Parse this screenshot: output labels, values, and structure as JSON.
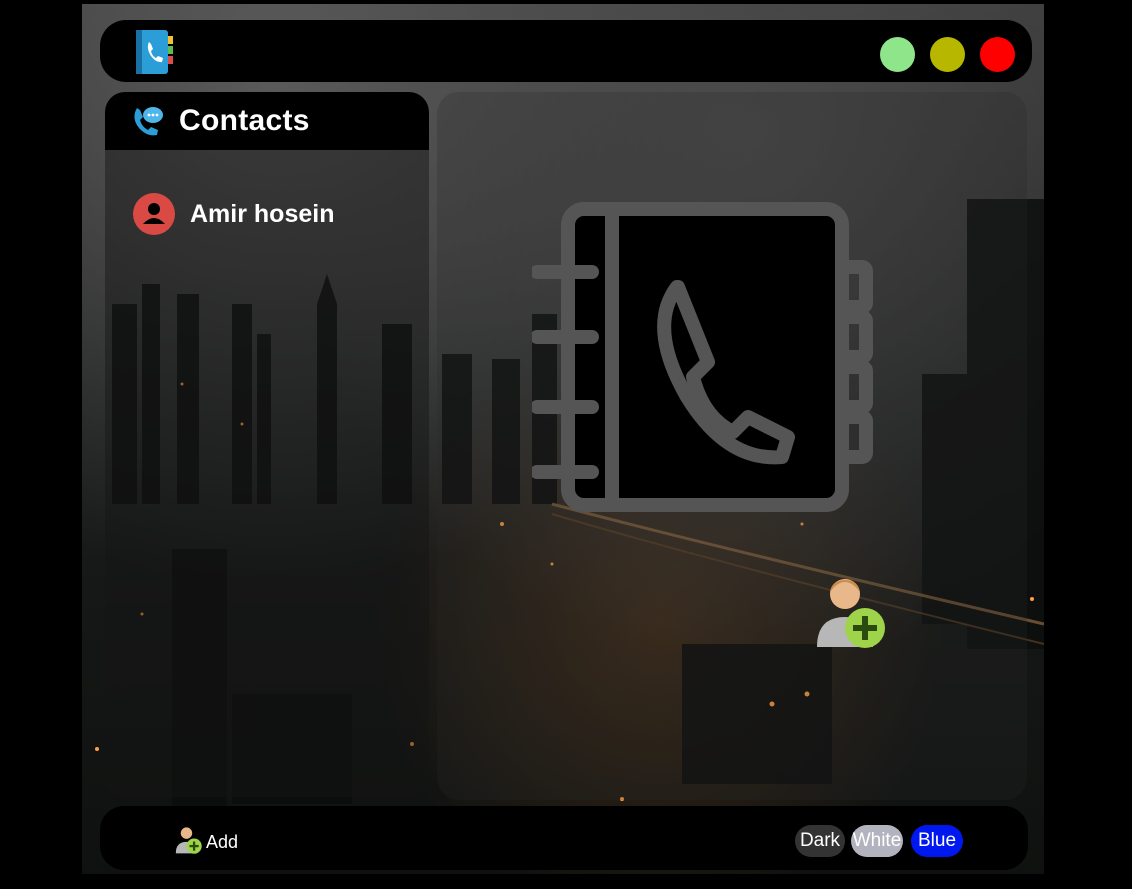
{
  "sidebar": {
    "title": "Contacts",
    "contacts": [
      {
        "name": "Amir hosein"
      }
    ]
  },
  "toolbar": {
    "add_label": "Add",
    "themes": [
      "Dark",
      "White",
      "Blue"
    ]
  },
  "icons": {
    "app": "contacts-book-icon",
    "header": "chat-phone-icon",
    "avatar": "user-avatar-icon",
    "main": "phonebook-icon",
    "add_contact": "add-user-icon"
  },
  "colors": {
    "minimize": "#8fe68a",
    "maximize": "#b8b700",
    "close": "#ff0000",
    "avatar": "#d94a45",
    "theme_dark": "#333333",
    "theme_white": "#b3b3c0",
    "theme_blue": "#0018f0"
  }
}
